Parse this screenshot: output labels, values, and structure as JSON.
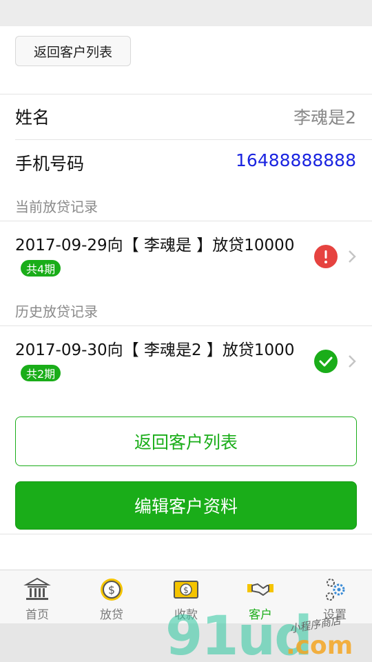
{
  "top_button": {
    "label": "返回客户列表"
  },
  "customer": {
    "name_label": "姓名",
    "name_value": "李魂是2",
    "phone_label": "手机号码",
    "phone_value": "16488888888"
  },
  "current_section": {
    "title": "当前放贷记录",
    "records": [
      {
        "text": "2017-09-29向【 李魂是 】放贷10000",
        "badge": "共4期",
        "status": "!"
      }
    ]
  },
  "history_section": {
    "title": "历史放贷记录",
    "records": [
      {
        "text": "2017-09-30向【 李魂是2 】放贷1000",
        "badge": "共2期",
        "status": "✓"
      }
    ]
  },
  "actions": {
    "back_label": "返回客户列表",
    "edit_label": "编辑客户资料"
  },
  "tabbar": {
    "items": [
      {
        "label": "首页",
        "icon": "bank-icon"
      },
      {
        "label": "放贷",
        "icon": "coin-icon"
      },
      {
        "label": "收款",
        "icon": "cash-icon"
      },
      {
        "label": "客户",
        "icon": "handshake-icon"
      },
      {
        "label": "设置",
        "icon": "gear-icon"
      }
    ],
    "active_index": 3
  },
  "watermark": {
    "brand": "91ud",
    "suffix": ".com",
    "tagline": "小程序商店"
  },
  "colors": {
    "accent": "#1aad19",
    "warn": "#e64340",
    "phone": "#1a24e0"
  }
}
